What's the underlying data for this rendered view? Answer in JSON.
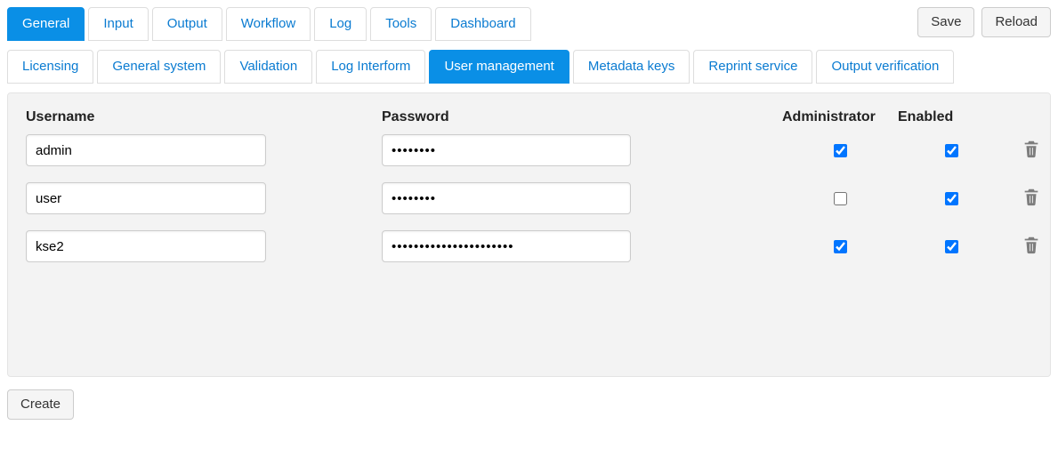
{
  "toolbar": {
    "save_label": "Save",
    "reload_label": "Reload"
  },
  "mainTabs": [
    {
      "label": "General",
      "active": true
    },
    {
      "label": "Input",
      "active": false
    },
    {
      "label": "Output",
      "active": false
    },
    {
      "label": "Workflow",
      "active": false
    },
    {
      "label": "Log",
      "active": false
    },
    {
      "label": "Tools",
      "active": false
    },
    {
      "label": "Dashboard",
      "active": false
    }
  ],
  "subTabs": [
    {
      "label": "Licensing",
      "active": false
    },
    {
      "label": "General system",
      "active": false
    },
    {
      "label": "Validation",
      "active": false
    },
    {
      "label": "Log Interform",
      "active": false
    },
    {
      "label": "User management",
      "active": true
    },
    {
      "label": "Metadata keys",
      "active": false
    },
    {
      "label": "Reprint service",
      "active": false
    },
    {
      "label": "Output verification",
      "active": false
    }
  ],
  "columns": {
    "username": "Username",
    "password": "Password",
    "administrator": "Administrator",
    "enabled": "Enabled"
  },
  "users": [
    {
      "username": "admin",
      "password": "••••••••",
      "administrator": true,
      "enabled": true
    },
    {
      "username": "user",
      "password": "••••••••",
      "administrator": false,
      "enabled": true
    },
    {
      "username": "kse2",
      "password": "••••••••••••••••••••••",
      "administrator": true,
      "enabled": true
    }
  ],
  "buttons": {
    "create_label": "Create"
  }
}
